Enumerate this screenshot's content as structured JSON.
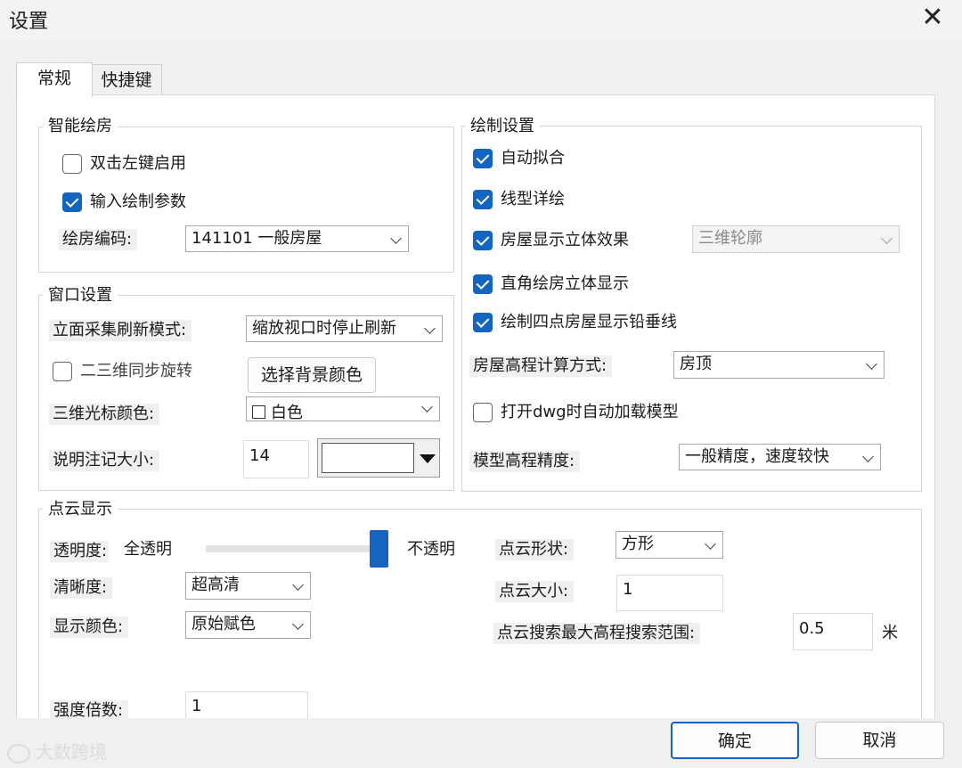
{
  "window": {
    "title": "设置"
  },
  "tabs": [
    "常规",
    "快捷键"
  ],
  "smart_draw": {
    "legend": "智能绘房",
    "double_click_enable": {
      "label": "双击左键启用",
      "checked": false
    },
    "input_params": {
      "label": "输入绘制参数",
      "checked": true
    },
    "house_code_label": "绘房编码:",
    "house_code_value": "141101 一般房屋"
  },
  "window_settings": {
    "legend": "窗口设置",
    "facade_refresh_label": "立面采集刷新模式:",
    "facade_refresh_value": "缩放视口时停止刷新",
    "sync_rotate": {
      "label": "二三维同步旋转",
      "checked": false
    },
    "bg_color_button": "选择背景颜色",
    "cursor_color_label": "三维光标颜色:",
    "cursor_color_value": "白色",
    "note_size_label": "说明注记大小:",
    "note_size_value": "14"
  },
  "draw_settings": {
    "legend": "绘制设置",
    "auto_fit": {
      "label": "自动拟合",
      "checked": true
    },
    "line_detail": {
      "label": "线型详绘",
      "checked": true
    },
    "house_3d": {
      "label": "房屋显示立体效果",
      "checked": true
    },
    "house_3d_mode": "三维轮廓",
    "right_angle_3d": {
      "label": "直角绘房立体显示",
      "checked": true
    },
    "four_point_vertical": {
      "label": "绘制四点房屋显示铅垂线",
      "checked": true
    },
    "elev_calc_label": "房屋高程计算方式:",
    "elev_calc_value": "房顶",
    "auto_load": {
      "label": "打开dwg时自动加载模型",
      "checked": false
    },
    "elev_precision_label": "模型高程精度:",
    "elev_precision_value": "一般精度，速度较快"
  },
  "point_cloud": {
    "legend": "点云显示",
    "opacity_label": "透明度:",
    "opacity_min": "全透明",
    "opacity_max": "不透明",
    "opacity_level": 1.0,
    "shape_label": "点云形状:",
    "shape_value": "方形",
    "clarity_label": "清晰度:",
    "clarity_value": "超高清",
    "size_label": "点云大小:",
    "size_value": "1",
    "color_label": "显示颜色:",
    "color_value": "原始赋色",
    "search_range_label": "点云搜索最大高程搜索范围:",
    "search_range_value": "0.5",
    "search_range_unit": "米",
    "intensity_label": "强度倍数:",
    "intensity_value": "1"
  },
  "buttons": {
    "ok": "确定",
    "cancel": "取消"
  },
  "watermark": "大数跨境",
  "colors": {
    "accent": "#1465c0",
    "slider_track": "#e2e2e2"
  }
}
